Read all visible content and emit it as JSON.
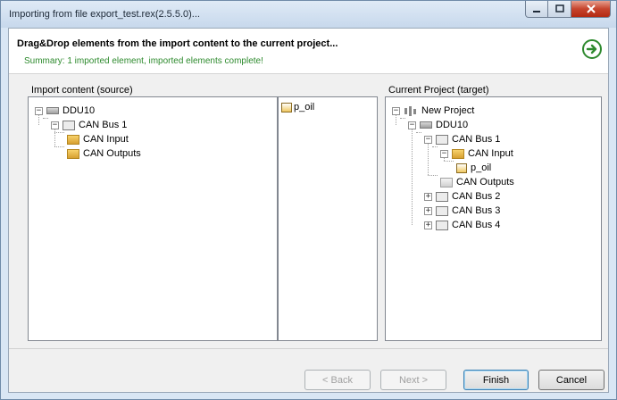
{
  "window": {
    "title": "Importing from file export_test.rex(2.5.5.0)..."
  },
  "header": {
    "title": "Drag&Drop elements from the import content to the current project...",
    "summary": "Summary: 1 imported element, imported elements complete!"
  },
  "source": {
    "label": "Import content (source)",
    "tree": [
      {
        "label": "DDU10",
        "icon": "device-icon",
        "expanded": true
      },
      {
        "label": "CAN Bus 1",
        "icon": "can-bus-icon",
        "expanded": true
      },
      {
        "label": "CAN Input",
        "icon": "folder-icon"
      },
      {
        "label": "CAN Outputs",
        "icon": "folder-icon"
      }
    ]
  },
  "middle": {
    "items": [
      {
        "label": "p_oil",
        "icon": "signal-icon"
      }
    ]
  },
  "target": {
    "label": "Current Project (target)",
    "tree": [
      {
        "label": "New Project",
        "icon": "project-icon",
        "expanded": true
      },
      {
        "label": "DDU10",
        "icon": "device-icon",
        "expanded": true
      },
      {
        "label": "CAN Bus 1",
        "icon": "can-bus-icon",
        "expanded": true
      },
      {
        "label": "CAN Input",
        "icon": "folder-icon",
        "expanded": true
      },
      {
        "label": "p_oil",
        "icon": "signal-icon"
      },
      {
        "label": "CAN Outputs",
        "icon": "folder-gray-icon"
      },
      {
        "label": "CAN Bus 2",
        "icon": "can-bus-icon",
        "expanded": false
      },
      {
        "label": "CAN Bus 3",
        "icon": "can-bus-icon",
        "expanded": false
      },
      {
        "label": "CAN Bus 4",
        "icon": "can-bus-icon",
        "expanded": false
      }
    ]
  },
  "buttons": {
    "back": "< Back",
    "next": "Next >",
    "finish": "Finish",
    "cancel": "Cancel"
  },
  "colors": {
    "summary_text": "#2d8a2d",
    "next_arrow": "#2f8a2f"
  }
}
